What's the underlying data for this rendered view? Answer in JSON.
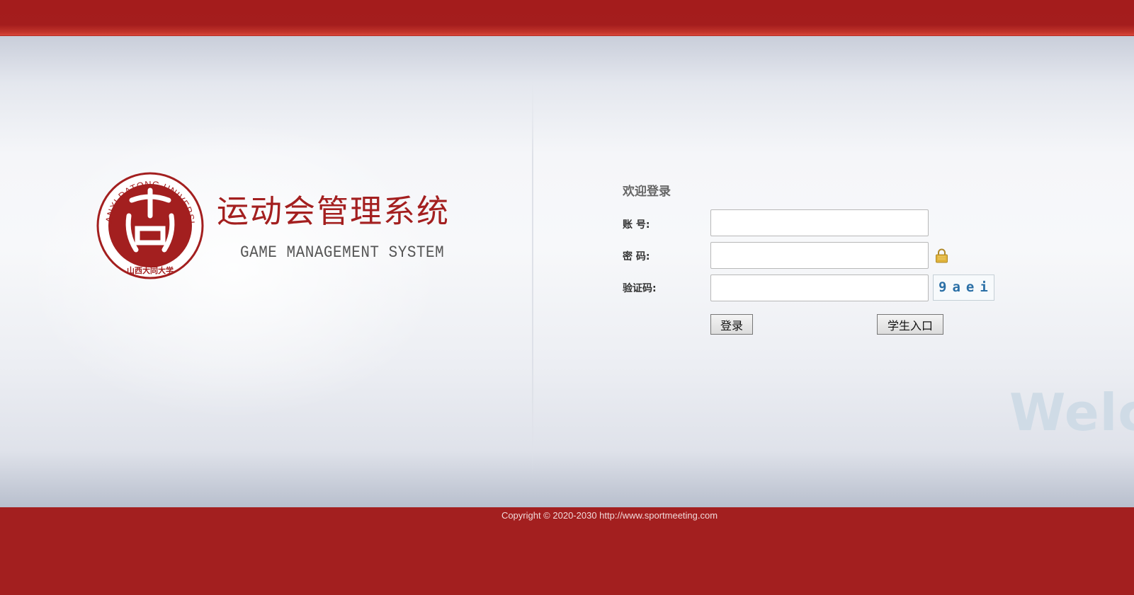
{
  "header": {},
  "brand": {
    "logo_text_top": "SHANXI DATONG UNIVERSITY",
    "logo_text_bottom": "山西大同大学",
    "title": "运动会管理系统",
    "subtitle": "GAME MANAGEMENT SYSTEM"
  },
  "login": {
    "heading": "欢迎登录",
    "account_label": "账 号:",
    "account_value": "",
    "password_label": "密 码:",
    "password_value": "",
    "captcha_label": "验证码:",
    "captcha_value": "",
    "captcha_image_text": "9aei",
    "login_button": "登录",
    "student_button": "学生入口"
  },
  "decor": {
    "watermark": "Welco"
  },
  "footer": {
    "copyright": "Copyright © 2020-2030 http://www.sportmeeting.com"
  },
  "colors": {
    "brand_red": "#a31f1f",
    "captcha_text": "#2a6fa6",
    "lock": "#d9a72a"
  },
  "icons": [
    "university-seal-logo",
    "lock-icon"
  ]
}
